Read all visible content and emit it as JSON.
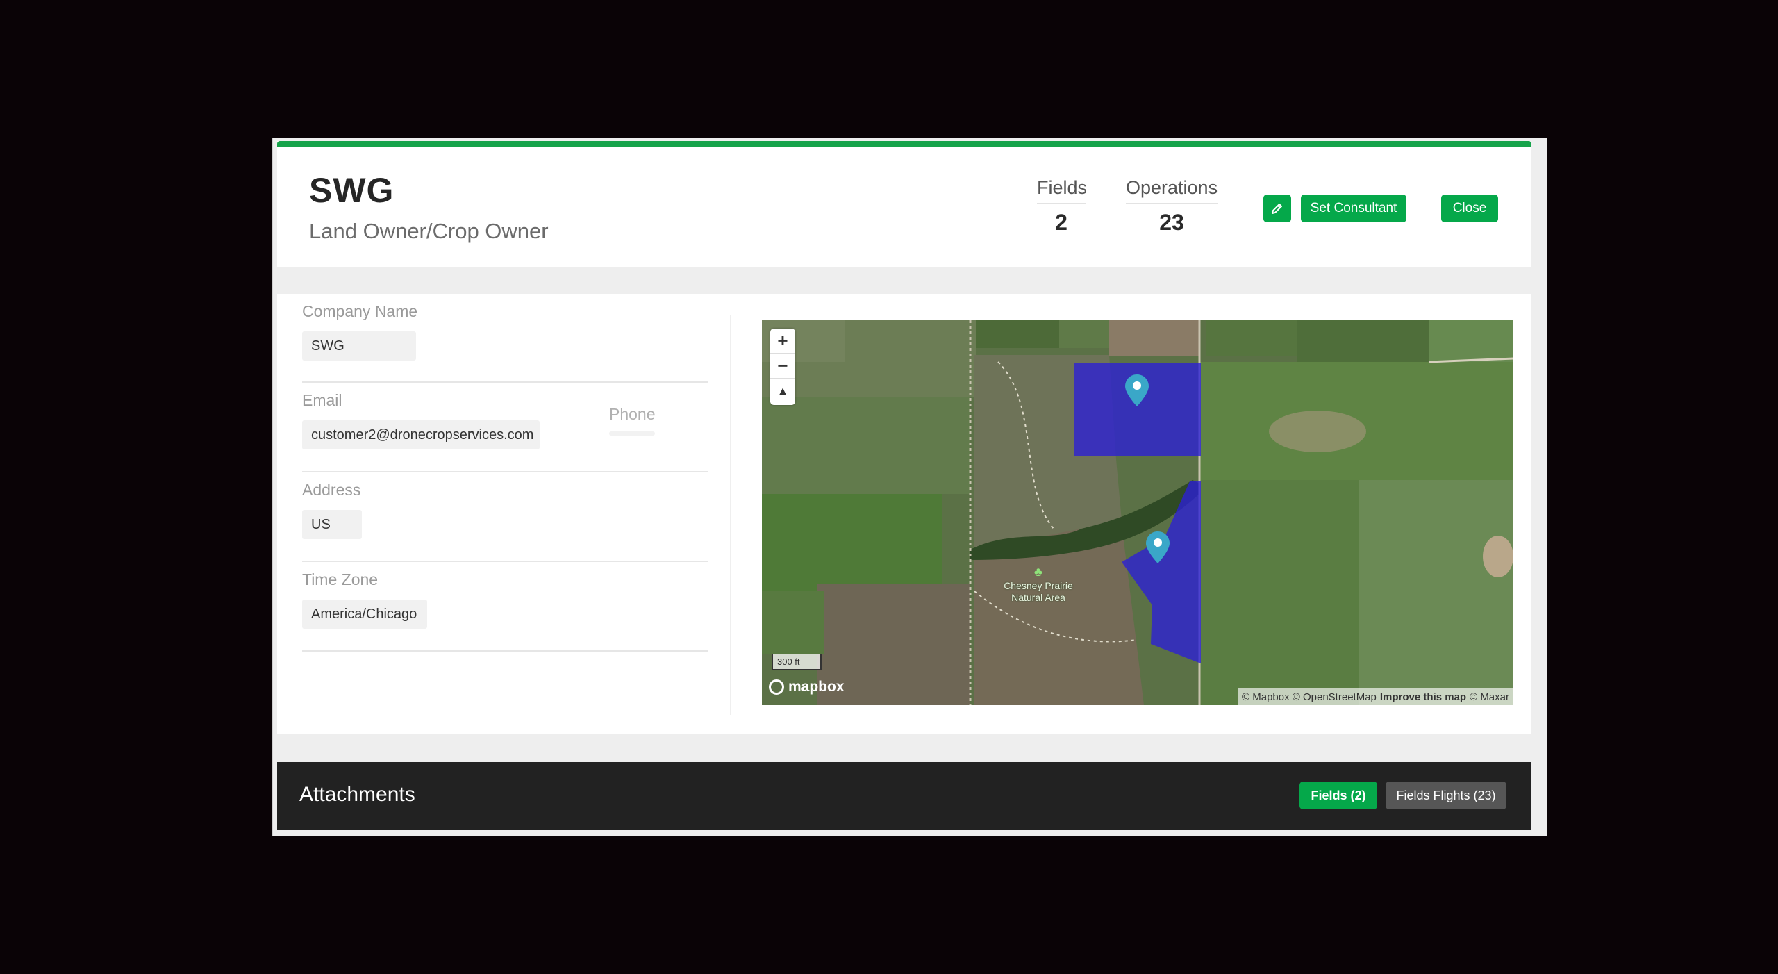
{
  "header": {
    "title": "SWG",
    "subtitle": "Land Owner/Crop Owner",
    "stats": {
      "fields_label": "Fields",
      "fields_value": "2",
      "operations_label": "Operations",
      "operations_value": "23"
    },
    "buttons": {
      "edit_icon": "pencil-icon",
      "set_consultant": "Set Consultant",
      "close": "Close"
    },
    "accent_color": "#05a84a"
  },
  "details": {
    "company_name_label": "Company Name",
    "company_name_value": "SWG",
    "email_label": "Email",
    "email_value": "customer2@dronecropservices.com",
    "phone_label": "Phone",
    "address_label": "Address",
    "address_value": "US",
    "timezone_label": "Time Zone",
    "timezone_value": "America/Chicago"
  },
  "map": {
    "zoom_in": "+",
    "zoom_out": "−",
    "compass": "▲",
    "scale_label": "300 ft",
    "logo_text": "mapbox",
    "place_label": "Chesney Prairie Natural Area",
    "attribution_1": "© Mapbox © OpenStreetMap",
    "attribution_2": "Improve this map",
    "attribution_3": "© Maxar",
    "field_color": "#2b1fd6",
    "marker_color": "#3aa7c8"
  },
  "attachments": {
    "title": "Attachments",
    "tab_fields": "Fields (2)",
    "tab_flights": "Fields Flights (23)"
  }
}
